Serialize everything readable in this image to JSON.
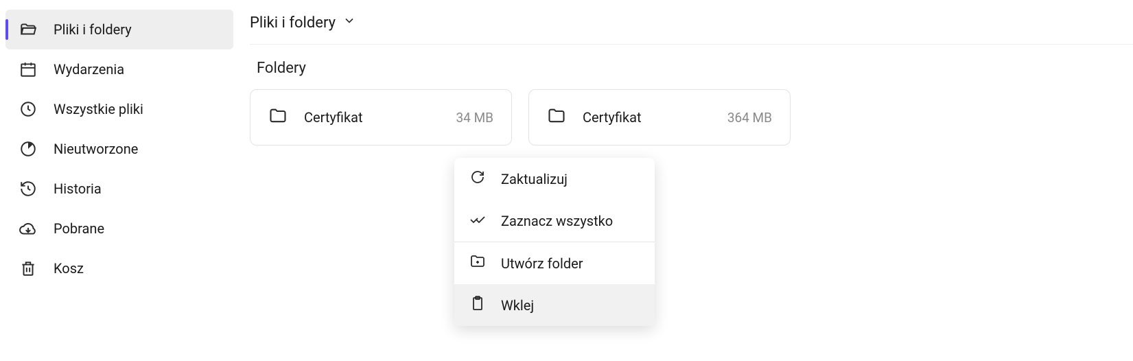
{
  "sidebar": {
    "items": [
      {
        "label": "Pliki i foldery"
      },
      {
        "label": "Wydarzenia"
      },
      {
        "label": "Wszystkie pliki"
      },
      {
        "label": "Nieutworzone"
      },
      {
        "label": "Historia"
      },
      {
        "label": "Pobrane"
      },
      {
        "label": "Kosz"
      }
    ]
  },
  "breadcrumb": {
    "current": "Pliki i foldery"
  },
  "section": {
    "title": "Foldery"
  },
  "folders": [
    {
      "name": "Certyfikat",
      "size": "34 MB"
    },
    {
      "name": "Certyfikat",
      "size": "364 MB"
    }
  ],
  "context_menu": {
    "refresh": "Zaktualizuj",
    "select_all": "Zaznacz wszystko",
    "create_folder": "Utwórz folder",
    "paste": "Wklej"
  }
}
